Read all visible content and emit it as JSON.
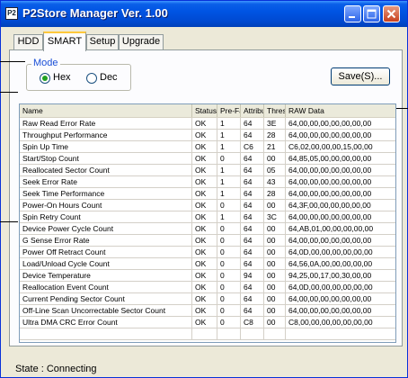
{
  "window": {
    "title": "P2Store Manager   Ver. 1.00",
    "icon_text": "P2"
  },
  "tabs": [
    {
      "label": "HDD"
    },
    {
      "label": "SMART"
    },
    {
      "label": "Setup"
    },
    {
      "label": "Upgrade"
    }
  ],
  "active_tab": "SMART",
  "mode": {
    "legend": "Mode",
    "options": [
      {
        "label": "Hex",
        "selected": true
      },
      {
        "label": "Dec",
        "selected": false
      }
    ]
  },
  "save_button": {
    "label": "Save(S)..."
  },
  "table": {
    "columns": [
      "Name",
      "Status",
      "Pre-Fa",
      "Attribu",
      "Thresh",
      "RAW Data"
    ],
    "rows": [
      [
        "Raw Read Error Rate",
        "OK",
        "1",
        "64",
        "3E",
        "64,00,00,00,00,00,00,00"
      ],
      [
        "Throughput Performance",
        "OK",
        "1",
        "64",
        "28",
        "64,00,00,00,00,00,00,00"
      ],
      [
        "Spin Up Time",
        "OK",
        "1",
        "C6",
        "21",
        "C6,02,00,00,00,15,00,00"
      ],
      [
        "Start/Stop Count",
        "OK",
        "0",
        "64",
        "00",
        "64,85,05,00,00,00,00,00"
      ],
      [
        "Reallocated Sector Count",
        "OK",
        "1",
        "64",
        "05",
        "64,00,00,00,00,00,00,00"
      ],
      [
        "Seek Error Rate",
        "OK",
        "1",
        "64",
        "43",
        "64,00,00,00,00,00,00,00"
      ],
      [
        "Seek Time Performance",
        "OK",
        "1",
        "64",
        "28",
        "64,00,00,00,00,00,00,00"
      ],
      [
        "Power-On Hours Count",
        "OK",
        "0",
        "64",
        "00",
        "64,3F,00,00,00,00,00,00"
      ],
      [
        "Spin Retry Count",
        "OK",
        "1",
        "64",
        "3C",
        "64,00,00,00,00,00,00,00"
      ],
      [
        "Device Power Cycle Count",
        "OK",
        "0",
        "64",
        "00",
        "64,AB,01,00,00,00,00,00"
      ],
      [
        "G Sense Error Rate",
        "OK",
        "0",
        "64",
        "00",
        "64,00,00,00,00,00,00,00"
      ],
      [
        "Power Off Retract Count",
        "OK",
        "0",
        "64",
        "00",
        "64,0D,00,00,00,00,00,00"
      ],
      [
        "Load/Unload Cycle Count",
        "OK",
        "0",
        "64",
        "00",
        "64,56,0A,00,00,00,00,00"
      ],
      [
        "Device Temperature",
        "OK",
        "0",
        "94",
        "00",
        "94,25,00,17,00,30,00,00"
      ],
      [
        "Reallocation Event Count",
        "OK",
        "0",
        "64",
        "00",
        "64,0D,00,00,00,00,00,00"
      ],
      [
        "Current Pending Sector Count",
        "OK",
        "0",
        "64",
        "00",
        "64,00,00,00,00,00,00,00"
      ],
      [
        "Off-Line Scan Uncorrectable Sector Count",
        "OK",
        "0",
        "64",
        "00",
        "64,00,00,00,00,00,00,00"
      ],
      [
        "Ultra DMA CRC Error Count",
        "OK",
        "0",
        "C8",
        "00",
        "C8,00,00,00,00,00,00,00"
      ]
    ]
  },
  "status": {
    "text": "State :  Connecting"
  },
  "colors": {
    "titlebar": "#0054e3",
    "active_tab_accent": "#ffc83c",
    "legend": "#1a4fd7",
    "radio_selected": "#21a121"
  },
  "icons": [
    "app-icon",
    "minimize-icon",
    "maximize-icon",
    "close-icon"
  ]
}
